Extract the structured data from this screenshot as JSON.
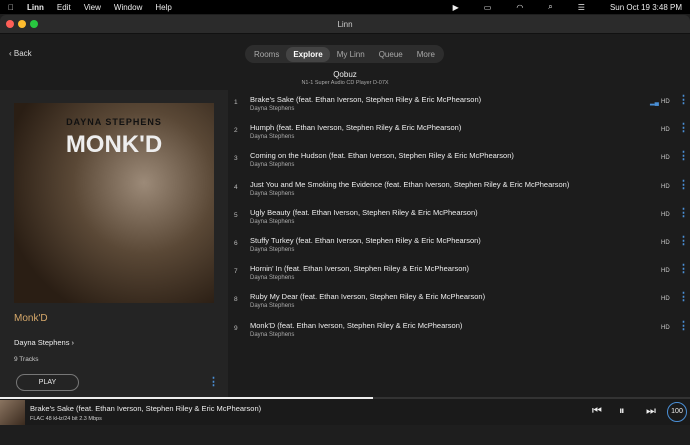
{
  "menubar": {
    "items": [
      "Linn",
      "Edit",
      "View",
      "Window",
      "Help"
    ],
    "clock": "Sun Oct 19  3:48 PM"
  },
  "window": {
    "title": "Linn"
  },
  "nav": {
    "back": "‹ Back",
    "tabs": [
      "Rooms",
      "Explore",
      "My Linn",
      "Queue",
      "More"
    ],
    "active_tab": "Explore"
  },
  "source": {
    "name": "Qobuz",
    "device": "N1-1 Super Audio CD Player D-07X"
  },
  "album": {
    "cover_title": "DAYNA STEPHENS",
    "cover_logo": "MONK'D",
    "title": "Monk'D",
    "artist": "Dayna Stephens ›",
    "track_count": "9 Tracks",
    "play_label": "PLAY"
  },
  "tracks": [
    {
      "num": "1",
      "title": "Brake's Sake (feat. Ethan Iverson, Stephen Riley & Eric McPhearson)",
      "artist": "Dayna Stephens",
      "quality": "HD",
      "playing": true
    },
    {
      "num": "2",
      "title": "Humph (feat. Ethan Iverson, Stephen Riley & Eric McPhearson)",
      "artist": "Dayna Stephens",
      "quality": "HD"
    },
    {
      "num": "3",
      "title": "Coming on the Hudson (feat. Ethan Iverson, Stephen Riley & Eric McPhearson)",
      "artist": "Dayna Stephens",
      "quality": "HD"
    },
    {
      "num": "4",
      "title": "Just You and Me Smoking the Evidence (feat. Ethan Iverson, Stephen Riley & Eric McPhearson)",
      "artist": "Dayna Stephens",
      "quality": "HD"
    },
    {
      "num": "5",
      "title": "Ugly Beauty (feat. Ethan Iverson, Stephen Riley & Eric McPhearson)",
      "artist": "Dayna Stephens",
      "quality": "HD"
    },
    {
      "num": "6",
      "title": "Stuffy Turkey (feat. Ethan Iverson, Stephen Riley & Eric McPhearson)",
      "artist": "Dayna Stephens",
      "quality": "HD"
    },
    {
      "num": "7",
      "title": "Hornin' In (feat. Ethan Iverson, Stephen Riley & Eric McPhearson)",
      "artist": "Dayna Stephens",
      "quality": "HD"
    },
    {
      "num": "8",
      "title": "Ruby My Dear (feat. Ethan Iverson, Stephen Riley & Eric McPhearson)",
      "artist": "Dayna Stephens",
      "quality": "HD"
    },
    {
      "num": "9",
      "title": "Monk'D (feat. Ethan Iverson, Stephen Riley & Eric McPhearson)",
      "artist": "Dayna Stephens",
      "quality": "HD"
    }
  ],
  "player": {
    "title": "Brake's Sake (feat. Ethan Iverson, Stephen Riley & Eric McPhearson)",
    "format": "FLAC 48 kHz/24 bit 2.3 Mbps",
    "progress_percent": 54,
    "volume": "100"
  },
  "colors": {
    "accent": "#4a8fd6",
    "album_title": "#d6a86a"
  }
}
